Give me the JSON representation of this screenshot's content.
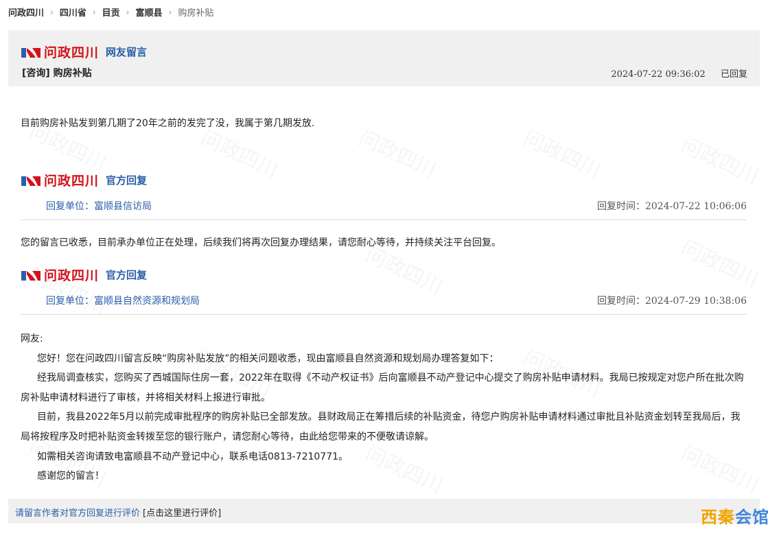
{
  "breadcrumb": {
    "items": [
      "问政四川",
      "四川省",
      "目贡",
      "富顺县"
    ],
    "current": "购房补贴"
  },
  "brand": {
    "name": "问政四川",
    "message_tag": "网友留言",
    "reply_tag": "官方回复",
    "colors": {
      "red": "#d3131b",
      "blue": "#2a5ea8"
    }
  },
  "question": {
    "title": "[咨询] 购房补贴",
    "datetime": "2024-07-22 09:36:02",
    "status": "已回复",
    "body": "目前购房补贴发到第几期了20年之前的发完了没，我属于第几期发放."
  },
  "replies": [
    {
      "unit_label": "回复单位：",
      "unit": "富顺县信访局",
      "time_label": "回复时间：",
      "time": "2024-07-22 10:06:06",
      "text": "您的留言已收悉，目前承办单位正在处理，后续我们将再次回复办理结果，请您耐心等待，并持续关注平台回复。"
    },
    {
      "unit_label": "回复单位：",
      "unit": "富顺县自然资源和规划局",
      "time_label": "回复时间：",
      "time": "2024-07-29 10:38:06",
      "paragraphs": [
        "网友:",
        "您好！您在问政四川留言反映“购房补贴发放”的相关问题收悉，现由富顺县自然资源和规划局办理答复如下：",
        "经我局调查核实，您购买了西城国际住房一套，2022年在取得《不动产权证书》后向富顺县不动产登记中心提交了购房补贴申请材料。我局已按规定对您户所在批次购房补贴申请材料进行了审核，并将相关材料上报进行审批。",
        "目前，我县2022年5月以前完成审批程序的购房补贴已全部发放。县财政局正在筹措后续的补贴资金，待您户购房补贴申请材料通过审批且补贴资金划转至我局后，我局将按程序及时把补贴资金转拨至您的银行账户，请您耐心等待，由此给您带来的不便敬请谅解。",
        "如需相关咨询请致电富顺县不动产登记中心，联系电话0813-7210771。",
        "感谢您的留言！"
      ]
    }
  ],
  "footer": {
    "rate_prompt": "请留言作者对官方回复进行评价",
    "rate_link": "[点击这里进行评价]"
  },
  "site_logo": {
    "main": "西秦",
    "sub": "会馆"
  }
}
